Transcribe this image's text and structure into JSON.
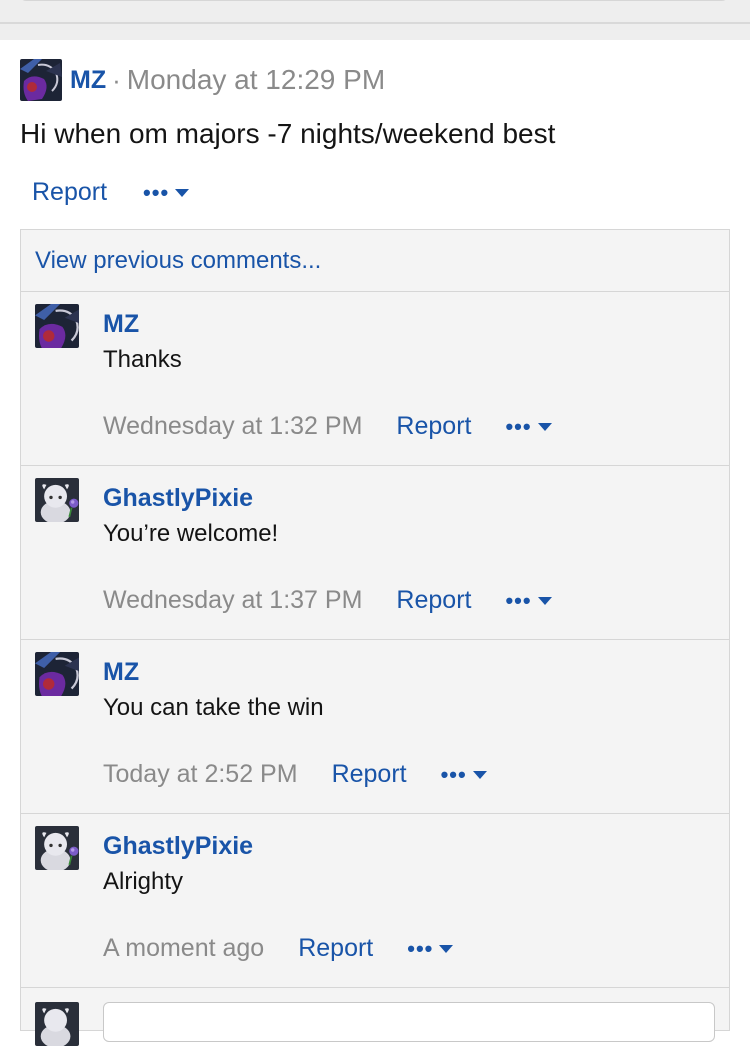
{
  "post": {
    "author": "MZ",
    "separator": "·",
    "time": "Monday at 12:29 PM",
    "message": "Hi when om majors -7 nights/weekend best",
    "report_label": "Report",
    "more_icon": "ellipsis-dropdown-icon"
  },
  "comments_section": {
    "view_previous_label": "View previous comments...",
    "report_label": "Report",
    "comments": [
      {
        "author": "MZ",
        "text": "Thanks",
        "time": "Wednesday at 1:32 PM",
        "avatar": "mz-avatar"
      },
      {
        "author": "GhastlyPixie",
        "text": "You’re welcome!",
        "time": "Wednesday at 1:37 PM",
        "avatar": "ghastlypixie-avatar"
      },
      {
        "author": "MZ",
        "text": "You can take the win",
        "time": "Today at 2:52 PM",
        "avatar": "mz-avatar"
      },
      {
        "author": "GhastlyPixie",
        "text": "Alrighty",
        "time": "A moment ago",
        "avatar": "ghastlypixie-avatar"
      }
    ],
    "reply": {
      "placeholder": ""
    }
  },
  "colors": {
    "link": "#1954a8",
    "muted": "#8a8a8a",
    "panel_bg": "#f4f4f4",
    "border": "#d6d6d6"
  }
}
